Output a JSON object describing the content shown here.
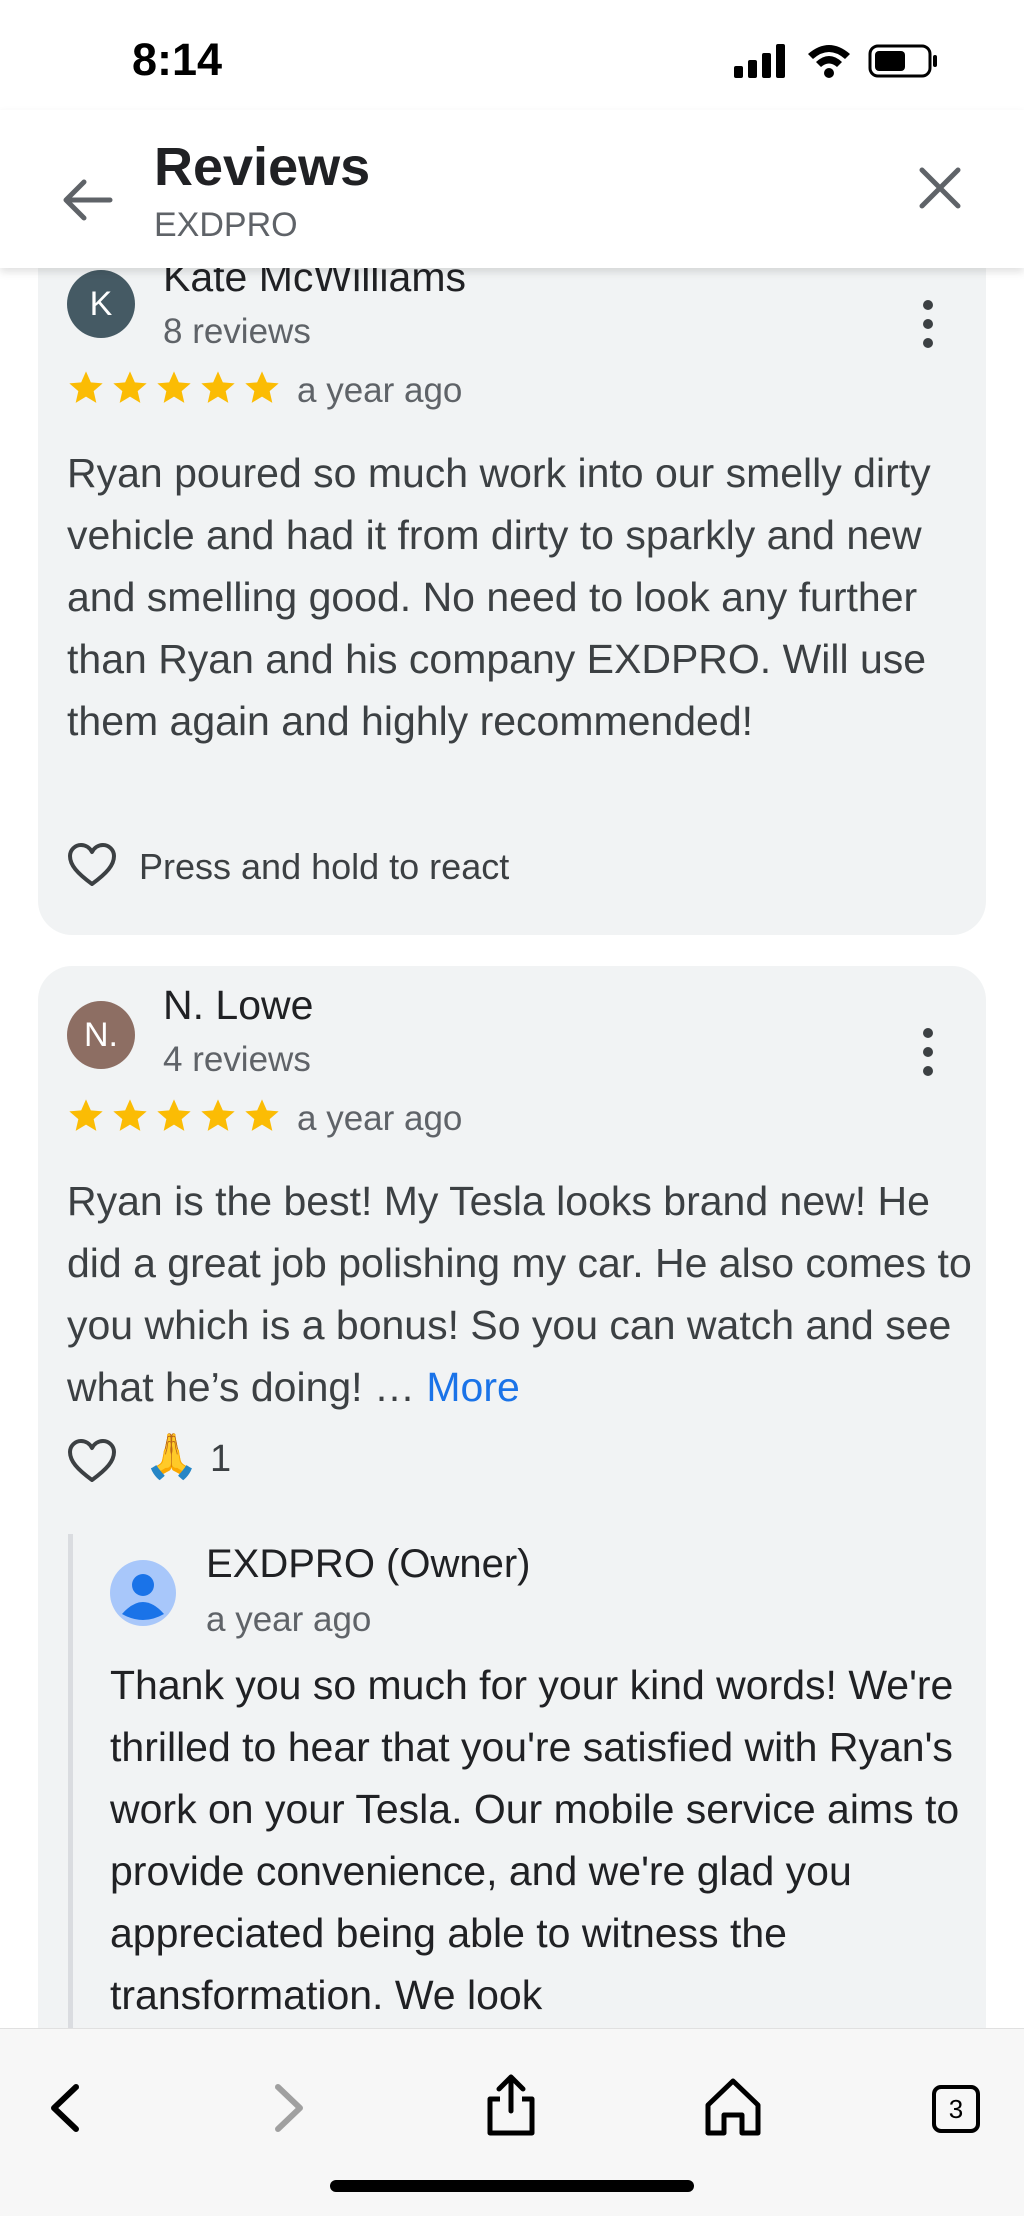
{
  "status": {
    "time": "8:14"
  },
  "header": {
    "title": "Reviews",
    "subtitle": "EXDPRO"
  },
  "reviews": [
    {
      "avatar_letter": "K",
      "avatar_color": "#455a64",
      "name": "Kate McWilliams",
      "review_count": "8 reviews",
      "rating": 5,
      "time": "a year ago",
      "text": "Ryan poured so much work into our smelly dirty vehicle and had it from dirty to sparkly and new and smelling good. No need to look any further than Ryan and his company EXDPRO. Will use them again and highly recommended!",
      "react_label": "Press and hold to react"
    },
    {
      "avatar_letter": "N.",
      "avatar_color": "#8d6e63",
      "name": "N. Lowe",
      "review_count": "4 reviews",
      "rating": 5,
      "time": "a year ago",
      "text": "Ryan is the best! My Tesla looks brand new! He did a great job polishing my car. He also comes to you which is a bonus! So you can watch and see what he’s doing! …",
      "more_label": "More",
      "reaction_emoji": "🙏",
      "reaction_count": "1",
      "owner_reply": {
        "name": "EXDPRO (Owner)",
        "time": "a year ago",
        "text": "Thank you so much for your kind words! We're thrilled to hear that you're satisfied with Ryan's work on your Tesla. Our mobile service aims to provide convenience, and we're glad you appreciated being able to witness the transformation. We look"
      }
    }
  ],
  "browser": {
    "tab_count": "3"
  },
  "colors": {
    "star": "#fbbc04",
    "link": "#1a73e8",
    "card_bg": "#f1f3f4"
  }
}
